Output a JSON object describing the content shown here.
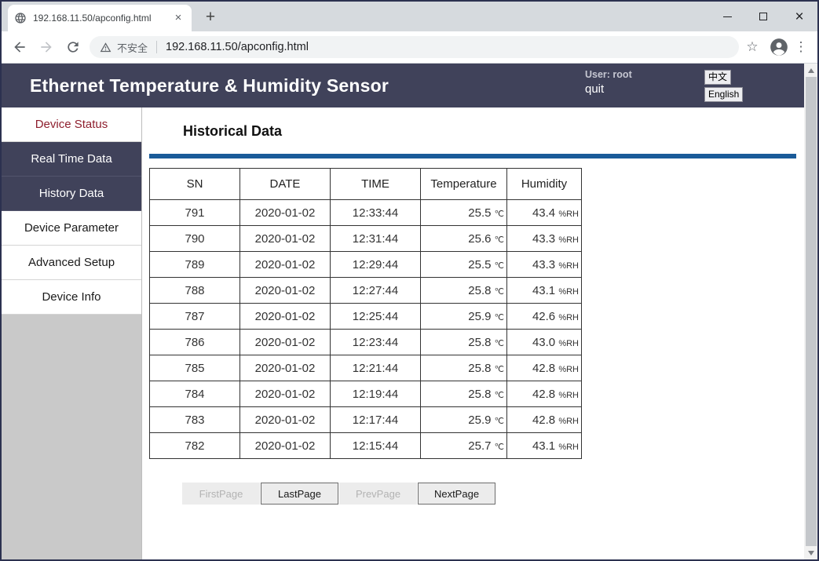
{
  "browser": {
    "tab_title": "192.168.11.50/apconfig.html",
    "security_label": "不安全",
    "url": "192.168.11.50/apconfig.html"
  },
  "icons": {
    "new_tab_glyph": "+",
    "close_glyph": "×",
    "star_glyph": "☆",
    "menu_glyph": "⋮"
  },
  "header": {
    "title": "Ethernet Temperature & Humidity Sensor",
    "user_label": "User: root",
    "quit_label": "quit",
    "lang_zh": "中文",
    "lang_en": "English"
  },
  "sidebar": {
    "items": [
      {
        "label": "Device Status",
        "state": "active-red"
      },
      {
        "label": "Real Time Data",
        "state": "dark"
      },
      {
        "label": "History Data",
        "state": "dark"
      },
      {
        "label": "Device Parameter",
        "state": "normal"
      },
      {
        "label": "Advanced Setup",
        "state": "normal"
      },
      {
        "label": "Device Info",
        "state": "normal"
      }
    ]
  },
  "main": {
    "heading": "Historical Data",
    "table": {
      "columns": [
        "SN",
        "DATE",
        "TIME",
        "Temperature",
        "Humidity"
      ],
      "temp_unit": "℃",
      "humidity_unit": "%RH",
      "rows": [
        {
          "sn": "791",
          "date": "2020-01-02",
          "time": "12:33:44",
          "temp": "25.5",
          "hum": "43.4"
        },
        {
          "sn": "790",
          "date": "2020-01-02",
          "time": "12:31:44",
          "temp": "25.6",
          "hum": "43.3"
        },
        {
          "sn": "789",
          "date": "2020-01-02",
          "time": "12:29:44",
          "temp": "25.5",
          "hum": "43.3"
        },
        {
          "sn": "788",
          "date": "2020-01-02",
          "time": "12:27:44",
          "temp": "25.8",
          "hum": "43.1"
        },
        {
          "sn": "787",
          "date": "2020-01-02",
          "time": "12:25:44",
          "temp": "25.9",
          "hum": "42.6"
        },
        {
          "sn": "786",
          "date": "2020-01-02",
          "time": "12:23:44",
          "temp": "25.8",
          "hum": "43.0"
        },
        {
          "sn": "785",
          "date": "2020-01-02",
          "time": "12:21:44",
          "temp": "25.8",
          "hum": "42.8"
        },
        {
          "sn": "784",
          "date": "2020-01-02",
          "time": "12:19:44",
          "temp": "25.8",
          "hum": "42.8"
        },
        {
          "sn": "783",
          "date": "2020-01-02",
          "time": "12:17:44",
          "temp": "25.9",
          "hum": "42.8"
        },
        {
          "sn": "782",
          "date": "2020-01-02",
          "time": "12:15:44",
          "temp": "25.7",
          "hum": "43.1"
        }
      ]
    },
    "pagination": [
      {
        "label": "FirstPage",
        "enabled": false
      },
      {
        "label": "LastPage",
        "enabled": true
      },
      {
        "label": "PrevPage",
        "enabled": false
      },
      {
        "label": "NextPage",
        "enabled": true
      }
    ]
  },
  "colors": {
    "header_navy": "#40425a",
    "accent_blue": "#1a5b99",
    "active_red": "#8e1f2e"
  }
}
